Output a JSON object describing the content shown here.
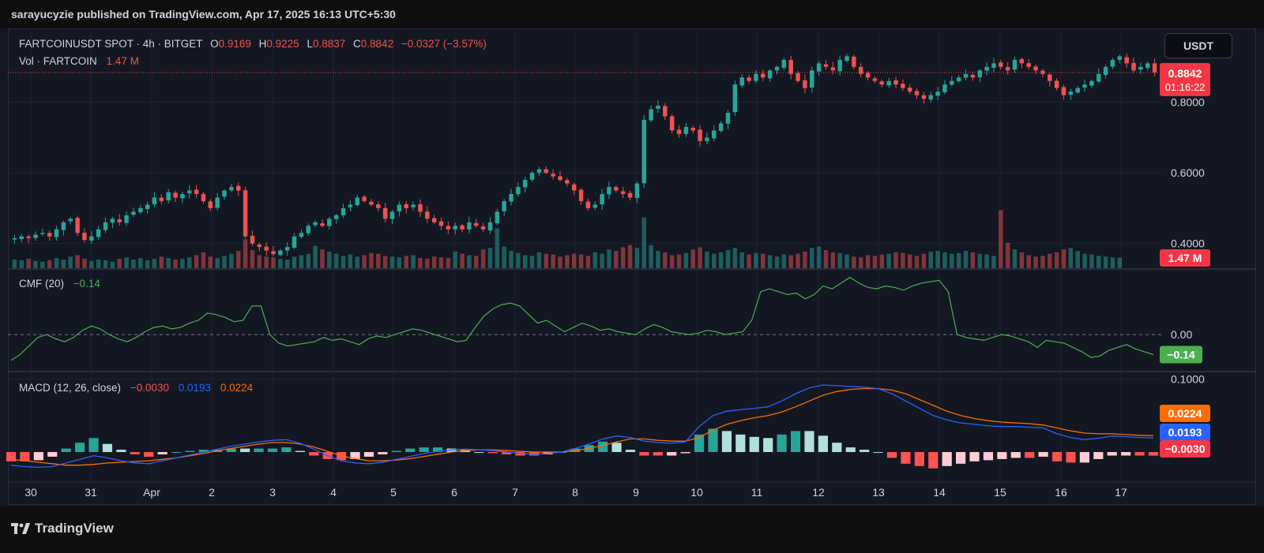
{
  "header": {
    "published": "sarayucyzie published on TradingView.com, Apr 17, 2025 16:13 UTC+5:30"
  },
  "legend": {
    "symbol": "FARTCOINUSDT SPOT · 4h · BITGET",
    "o_label": "O",
    "o_value": "0.9169",
    "h_label": "H",
    "h_value": "0.9225",
    "l_label": "L",
    "l_value": "0.8837",
    "c_label": "C",
    "c_value": "0.8842",
    "change": "−0.0327 (−3.57%)",
    "vol_label": "Vol · FARTCOIN",
    "vol_value": "1.47 M",
    "cmf_label": "CMF (20)",
    "cmf_value": "−0.14",
    "macd_label": "MACD (12, 26, close)",
    "macd_hist": "−0.0030",
    "macd_line": "0.0193",
    "macd_signal": "0.0224"
  },
  "currency_button": "USDT",
  "price_badge": {
    "price": "0.8842",
    "countdown": "01:16:22"
  },
  "volume_badge": "1.47 M",
  "cmf_badge": "−0.14",
  "macd_badges": {
    "signal": "0.0224",
    "macd": "0.0193",
    "hist": "−0.0030"
  },
  "price_axis_ticks": [
    "0.8000",
    "0.6000",
    "0.4000"
  ],
  "cmf_axis_ticks": [
    "0.00"
  ],
  "macd_axis_ticks": [
    "0.1000"
  ],
  "time_axis_ticks": [
    "30",
    "31",
    "Apr",
    "2",
    "3",
    "4",
    "5",
    "6",
    "7",
    "8",
    "9",
    "10",
    "11",
    "12",
    "13",
    "14",
    "15",
    "16",
    "17"
  ],
  "footer": {
    "logo_text": "TradingView"
  },
  "colors": {
    "up": "#26a69a",
    "down": "#ef5350",
    "cmf": "#4caf50",
    "macd": "#2962ff",
    "signal": "#ff6d00",
    "bg": "#131722"
  },
  "chart_data": [
    {
      "type": "candlestick",
      "title": "FARTCOINUSDT SPOT · 4h · BITGET",
      "x_ticks": [
        "30",
        "31",
        "Apr",
        "2",
        "3",
        "4",
        "5",
        "6",
        "7",
        "8",
        "9",
        "10",
        "11",
        "12",
        "13",
        "14",
        "15",
        "16",
        "17"
      ],
      "ylim": [
        0.33,
        1.0
      ],
      "y_ticks": [
        0.4,
        0.6,
        0.8
      ],
      "close_path": [
        0.415,
        0.42,
        0.415,
        0.425,
        0.43,
        0.42,
        0.44,
        0.46,
        0.47,
        0.43,
        0.41,
        0.42,
        0.44,
        0.46,
        0.47,
        0.46,
        0.48,
        0.49,
        0.5,
        0.51,
        0.53,
        0.52,
        0.545,
        0.53,
        0.54,
        0.55,
        0.54,
        0.52,
        0.5,
        0.53,
        0.55,
        0.56,
        0.55,
        0.42,
        0.4,
        0.39,
        0.38,
        0.37,
        0.38,
        0.39,
        0.42,
        0.43,
        0.45,
        0.46,
        0.45,
        0.47,
        0.48,
        0.5,
        0.51,
        0.53,
        0.52,
        0.51,
        0.5,
        0.47,
        0.49,
        0.51,
        0.5,
        0.51,
        0.49,
        0.47,
        0.46,
        0.45,
        0.44,
        0.45,
        0.44,
        0.46,
        0.45,
        0.44,
        0.46,
        0.49,
        0.52,
        0.54,
        0.56,
        0.58,
        0.6,
        0.61,
        0.6,
        0.59,
        0.58,
        0.57,
        0.55,
        0.52,
        0.5,
        0.51,
        0.54,
        0.56,
        0.55,
        0.54,
        0.53,
        0.57,
        0.75,
        0.78,
        0.79,
        0.76,
        0.72,
        0.71,
        0.73,
        0.72,
        0.69,
        0.7,
        0.72,
        0.74,
        0.77,
        0.85,
        0.87,
        0.86,
        0.88,
        0.87,
        0.89,
        0.9,
        0.92,
        0.88,
        0.86,
        0.84,
        0.89,
        0.91,
        0.9,
        0.89,
        0.92,
        0.93,
        0.9,
        0.88,
        0.87,
        0.86,
        0.85,
        0.86,
        0.85,
        0.84,
        0.83,
        0.82,
        0.81,
        0.82,
        0.83,
        0.85,
        0.86,
        0.87,
        0.88,
        0.87,
        0.89,
        0.9,
        0.91,
        0.9,
        0.89,
        0.92,
        0.91,
        0.9,
        0.89,
        0.88,
        0.86,
        0.84,
        0.82,
        0.83,
        0.84,
        0.85,
        0.86,
        0.88,
        0.9,
        0.92,
        0.93,
        0.91,
        0.89,
        0.9,
        0.91,
        0.8842
      ]
    },
    {
      "type": "bar",
      "title": "Vol · FARTCOIN",
      "unit": "M",
      "current": 1.47,
      "values": [
        1.2,
        1.1,
        1.3,
        1.0,
        0.9,
        1.1,
        1.4,
        1.2,
        1.6,
        1.8,
        1.3,
        1.0,
        1.2,
        1.1,
        0.9,
        1.3,
        1.5,
        1.2,
        1.4,
        1.1,
        1.3,
        1.6,
        1.4,
        1.2,
        1.3,
        1.5,
        1.8,
        2.2,
        1.6,
        1.4,
        1.7,
        2.0,
        2.4,
        4.0,
        2.5,
        1.8,
        1.6,
        1.5,
        1.3,
        1.2,
        1.6,
        1.8,
        2.0,
        3.1,
        2.6,
        2.3,
        2.0,
        1.7,
        1.9,
        1.6,
        1.8,
        2.1,
        2.0,
        1.7,
        1.6,
        1.5,
        1.7,
        1.8,
        1.4,
        1.3,
        1.6,
        1.5,
        1.4,
        2.3,
        2.0,
        1.8,
        1.7,
        2.6,
        2.8,
        5.5,
        3.0,
        2.4,
        2.1,
        1.8,
        1.7,
        2.2,
        2.0,
        1.9,
        1.6,
        1.8,
        2.0,
        1.9,
        1.7,
        2.2,
        2.0,
        2.6,
        2.4,
        2.9,
        3.2,
        2.8,
        7.0,
        3.2,
        2.4,
        2.2,
        1.8,
        1.9,
        2.1,
        2.6,
        2.9,
        2.3,
        2.0,
        2.2,
        2.5,
        2.8,
        2.2,
        1.9,
        2.1,
        2.0,
        1.8,
        1.6,
        1.9,
        1.8,
        2.0,
        2.3,
        2.8,
        3.0,
        2.5,
        2.2,
        2.1,
        1.9,
        1.6,
        1.5,
        1.8,
        1.7,
        1.9,
        2.0,
        2.2,
        2.1,
        1.9,
        1.7,
        2.0,
        2.3,
        2.4,
        2.2,
        2.0,
        2.1,
        2.4,
        2.2,
        2.0,
        1.9,
        1.7,
        8.0,
        3.5,
        2.6,
        2.2,
        1.8,
        1.6,
        1.7,
        2.0,
        2.2,
        2.6,
        2.8,
        2.4,
        2.0,
        1.9,
        1.7,
        1.6,
        1.5,
        1.47
      ]
    },
    {
      "type": "line",
      "title": "CMF (20)",
      "series": [
        {
          "name": "CMF (20)",
          "values": [
            -0.18,
            -0.14,
            -0.08,
            -0.02,
            0.0,
            -0.03,
            -0.05,
            -0.02,
            0.03,
            0.06,
            0.04,
            0.0,
            -0.03,
            -0.05,
            -0.02,
            0.02,
            0.05,
            0.06,
            0.04,
            0.05,
            0.08,
            0.1,
            0.15,
            0.14,
            0.12,
            0.09,
            0.1,
            0.2,
            0.2,
            0.0,
            -0.06,
            -0.08,
            -0.07,
            -0.06,
            -0.05,
            -0.02,
            -0.04,
            -0.03,
            -0.05,
            -0.07,
            -0.03,
            -0.01,
            -0.02,
            0.0,
            0.02,
            0.04,
            0.03,
            0.01,
            -0.01,
            -0.03,
            -0.05,
            -0.04,
            0.05,
            0.13,
            0.18,
            0.21,
            0.22,
            0.2,
            0.14,
            0.08,
            0.1,
            0.06,
            0.02,
            0.05,
            0.08,
            0.06,
            0.03,
            0.04,
            0.02,
            0.01,
            0.0,
            0.04,
            0.07,
            0.05,
            0.02,
            0.01,
            0.0,
            0.01,
            0.03,
            0.02,
            0.0,
            0.01,
            0.02,
            0.1,
            0.3,
            0.32,
            0.3,
            0.28,
            0.29,
            0.25,
            0.28,
            0.34,
            0.32,
            0.36,
            0.4,
            0.36,
            0.33,
            0.32,
            0.34,
            0.33,
            0.31,
            0.34,
            0.36,
            0.37,
            0.38,
            0.3,
            0.0,
            -0.02,
            -0.03,
            -0.04,
            -0.02,
            0.0,
            -0.01,
            -0.03,
            -0.05,
            -0.09,
            -0.04,
            -0.05,
            -0.06,
            -0.09,
            -0.12,
            -0.16,
            -0.15,
            -0.11,
            -0.09,
            -0.07,
            -0.1,
            -0.12,
            -0.14
          ]
        }
      ],
      "ylim": [
        -0.22,
        0.42
      ],
      "y_ticks": [
        0.0
      ],
      "current": -0.14
    },
    {
      "type": "line",
      "title": "MACD (12, 26, close)",
      "series": [
        {
          "name": "MACD",
          "values": [
            -0.018,
            -0.02,
            -0.021,
            -0.02,
            -0.015,
            -0.01,
            -0.005,
            -0.008,
            -0.012,
            -0.015,
            -0.016,
            -0.012,
            -0.008,
            -0.004,
            0.0,
            0.004,
            0.008,
            0.011,
            0.014,
            0.016,
            0.017,
            0.012,
            0.004,
            -0.005,
            -0.012,
            -0.015,
            -0.016,
            -0.014,
            -0.01,
            -0.006,
            -0.002,
            0.001,
            0.003,
            0.004,
            0.003,
            0.002,
            0.0,
            -0.002,
            -0.003,
            -0.002,
            0.0,
            0.005,
            0.011,
            0.018,
            0.022,
            0.02,
            0.015,
            0.013,
            0.012,
            0.014,
            0.035,
            0.05,
            0.056,
            0.058,
            0.06,
            0.062,
            0.07,
            0.08,
            0.088,
            0.092,
            0.091,
            0.09,
            0.089,
            0.087,
            0.08,
            0.07,
            0.06,
            0.05,
            0.044,
            0.04,
            0.038,
            0.036,
            0.035,
            0.035,
            0.034,
            0.033,
            0.025,
            0.02,
            0.017,
            0.019,
            0.022,
            0.021,
            0.02,
            0.0193
          ]
        },
        {
          "name": "Signal",
          "values": [
            -0.01,
            -0.012,
            -0.014,
            -0.016,
            -0.018,
            -0.018,
            -0.017,
            -0.015,
            -0.014,
            -0.013,
            -0.012,
            -0.01,
            -0.008,
            -0.005,
            -0.002,
            0.002,
            0.005,
            0.008,
            0.011,
            0.013,
            0.013,
            0.011,
            0.007,
            0.001,
            -0.005,
            -0.009,
            -0.012,
            -0.012,
            -0.011,
            -0.009,
            -0.006,
            -0.003,
            0.0,
            0.002,
            0.003,
            0.003,
            0.002,
            0.001,
            0.0,
            0.0,
            0.0,
            0.002,
            0.005,
            0.009,
            0.014,
            0.018,
            0.018,
            0.016,
            0.015,
            0.015,
            0.02,
            0.03,
            0.038,
            0.043,
            0.047,
            0.05,
            0.055,
            0.062,
            0.07,
            0.078,
            0.083,
            0.086,
            0.087,
            0.087,
            0.085,
            0.08,
            0.072,
            0.064,
            0.056,
            0.05,
            0.046,
            0.043,
            0.041,
            0.04,
            0.039,
            0.037,
            0.033,
            0.029,
            0.026,
            0.025,
            0.025,
            0.024,
            0.023,
            0.0224
          ]
        }
      ],
      "histogram": {
        "name": "Histogram",
        "current": -0.003
      },
      "ylim": [
        -0.04,
        0.105
      ],
      "y_ticks": [
        0.1
      ],
      "legend": "top-left"
    }
  ]
}
